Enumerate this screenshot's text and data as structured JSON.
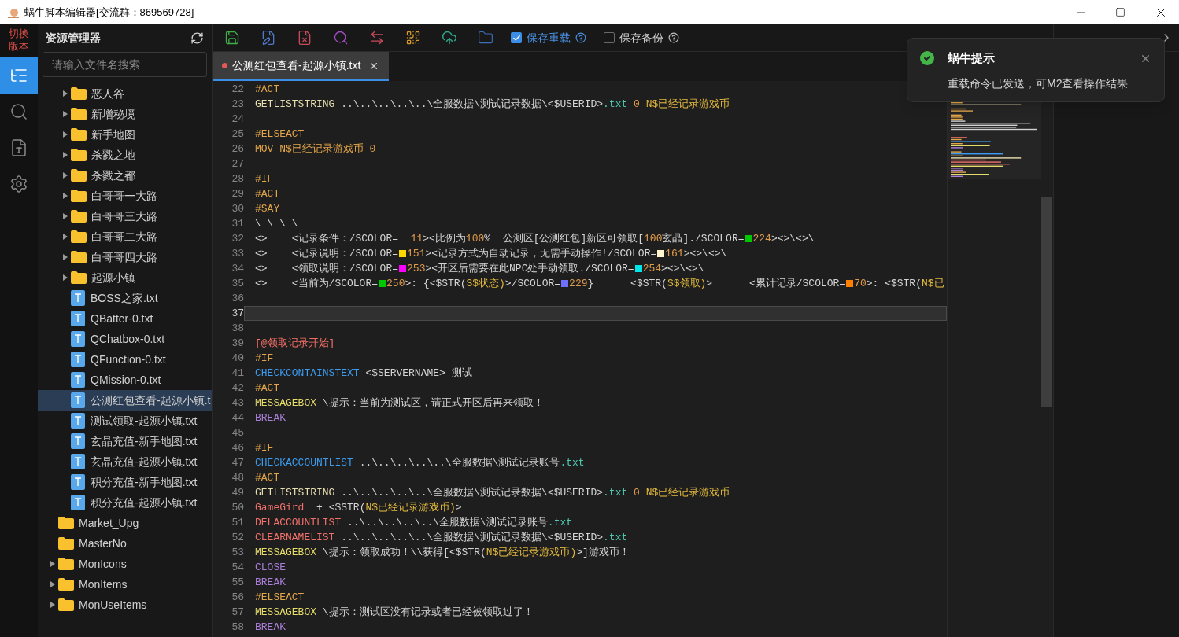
{
  "window": {
    "title": "蜗牛脚本编辑器[交流群：869569728]"
  },
  "activity_bar": {
    "switch_label": "切换版本",
    "items": [
      {
        "selected": true
      },
      {
        "selected": false
      },
      {
        "selected": false
      },
      {
        "selected": false
      }
    ]
  },
  "explorer": {
    "title": "资源管理器",
    "search": {
      "placeholder": "请输入文件名搜索"
    },
    "inner_items": [
      {
        "kind": "folder",
        "label": "恶人谷",
        "selected": false
      },
      {
        "kind": "folder",
        "label": "新增秘境",
        "selected": false
      },
      {
        "kind": "folder",
        "label": "新手地图",
        "selected": false
      },
      {
        "kind": "folder",
        "label": "杀戮之地",
        "selected": false
      },
      {
        "kind": "folder",
        "label": "杀戮之都",
        "selected": false
      },
      {
        "kind": "folder",
        "label": "白哥哥一大路",
        "selected": false
      },
      {
        "kind": "folder",
        "label": "白哥哥三大路",
        "selected": false
      },
      {
        "kind": "folder",
        "label": "白哥哥二大路",
        "selected": false
      },
      {
        "kind": "folder",
        "label": "白哥哥四大路",
        "selected": false
      },
      {
        "kind": "folder",
        "label": "起源小镇",
        "selected": false
      },
      {
        "kind": "file",
        "label": "BOSS之家.txt",
        "selected": false
      },
      {
        "kind": "file",
        "label": "QBatter-0.txt",
        "selected": false
      },
      {
        "kind": "file",
        "label": "QChatbox-0.txt",
        "selected": false
      },
      {
        "kind": "file",
        "label": "QFunction-0.txt",
        "selected": false
      },
      {
        "kind": "file",
        "label": "QMission-0.txt",
        "selected": false
      },
      {
        "kind": "file",
        "label": "公测红包查看-起源小镇.t",
        "selected": true
      },
      {
        "kind": "file",
        "label": "测试领取-起源小镇.txt",
        "selected": false
      },
      {
        "kind": "file",
        "label": "玄晶充值-新手地图.txt",
        "selected": false
      },
      {
        "kind": "file",
        "label": "玄晶充值-起源小镇.txt",
        "selected": false
      },
      {
        "kind": "file",
        "label": "积分充值-新手地图.txt",
        "selected": false
      },
      {
        "kind": "file",
        "label": "积分充值-起源小镇.txt",
        "selected": false
      }
    ],
    "outer_items": [
      {
        "kind": "leaf-folder",
        "label": "Market_Upg",
        "selected": false
      },
      {
        "kind": "leaf-folder",
        "label": "MasterNo",
        "selected": false
      },
      {
        "kind": "folder",
        "label": "MonIcons",
        "selected": false
      },
      {
        "kind": "folder",
        "label": "MonItems",
        "selected": false
      },
      {
        "kind": "folder",
        "label": "MonUseItems",
        "selected": false
      }
    ]
  },
  "toolbar": {
    "options": [
      {
        "label": "保存重载",
        "checked": true
      },
      {
        "label": "保存备份",
        "checked": false
      }
    ]
  },
  "tab": {
    "label": "公测红包查看-起源小镇.txt",
    "modified": true
  },
  "editor": {
    "lines": [
      {
        "n": "22",
        "current": false,
        "tokens": [
          {
            "kind": "dir",
            "text": "#ACT"
          }
        ]
      },
      {
        "n": "23",
        "current": false,
        "tokens": [
          {
            "kind": "cmd",
            "text": "GETLISTSTRING"
          },
          {
            "kind": "txt",
            "text": " ..\\..\\..\\..\\..\\全服数据\\测试记录数据\\<$USERID>"
          },
          {
            "kind": "ext",
            "text": ".txt"
          },
          {
            "kind": "num",
            "text": " 0"
          },
          {
            "kind": "var",
            "text": " N$已经记录游戏币"
          }
        ]
      },
      {
        "n": "24",
        "current": false
      },
      {
        "n": "25",
        "current": false,
        "tokens": [
          {
            "kind": "dir",
            "text": "#ELSEACT"
          }
        ]
      },
      {
        "n": "26",
        "current": false,
        "tokens": [
          {
            "kind": "dir",
            "text": "MOV N$已经记录游戏币 0"
          }
        ]
      },
      {
        "n": "27",
        "current": false
      },
      {
        "n": "28",
        "current": false,
        "tokens": [
          {
            "kind": "dir",
            "text": "#IF"
          }
        ]
      },
      {
        "n": "29",
        "current": false,
        "tokens": [
          {
            "kind": "dir",
            "text": "#ACT"
          }
        ]
      },
      {
        "n": "30",
        "current": false,
        "tokens": [
          {
            "kind": "dir",
            "text": "#SAY"
          }
        ]
      },
      {
        "n": "31",
        "current": false,
        "tokens": [
          {
            "kind": "txt",
            "text": "\\ \\ \\ \\"
          }
        ]
      },
      {
        "n": "32",
        "current": false,
        "tokens": [
          {
            "kind": "txt",
            "text": "<>    <记录条件：/SCOLOR=  "
          },
          {
            "kind": "num",
            "text": "11"
          },
          {
            "kind": "txt",
            "text": "><比例为"
          },
          {
            "kind": "num",
            "text": "100"
          },
          {
            "kind": "txt",
            "text": "%  公测区[公测红包]新区可领取["
          },
          {
            "kind": "num",
            "text": "100"
          },
          {
            "kind": "txt",
            "text": "玄晶]./SCOLOR="
          },
          {
            "kind": "swatch",
            "color": "#00c800"
          },
          {
            "kind": "num",
            "text": "224"
          },
          {
            "kind": "txt",
            "text": "><>\\<>\\"
          }
        ]
      },
      {
        "n": "33",
        "current": false,
        "tokens": [
          {
            "kind": "txt",
            "text": "<>    <记录说明：/SCOLOR="
          },
          {
            "kind": "swatch",
            "color": "#ffd700"
          },
          {
            "kind": "num",
            "text": "151"
          },
          {
            "kind": "txt",
            "text": "><记录方式为自动记录，无需手动操作!/SCOLOR="
          },
          {
            "kind": "swatch",
            "color": "#fff5cc"
          },
          {
            "kind": "num",
            "text": "161"
          },
          {
            "kind": "txt",
            "text": "><>\\<>\\"
          }
        ]
      },
      {
        "n": "34",
        "current": false,
        "tokens": [
          {
            "kind": "txt",
            "text": "<>    <领取说明：/SCOLOR="
          },
          {
            "kind": "swatch",
            "color": "#ff00ff"
          },
          {
            "kind": "num",
            "text": "253"
          },
          {
            "kind": "txt",
            "text": "><开区后需要在此NPC处手动领取./SCOLOR="
          },
          {
            "kind": "swatch",
            "color": "#00e5e5"
          },
          {
            "kind": "num",
            "text": "254"
          },
          {
            "kind": "txt",
            "text": "><>\\<>\\"
          }
        ]
      },
      {
        "n": "35",
        "current": false,
        "tokens": [
          {
            "kind": "txt",
            "text": "<>    <当前为/SCOLOR="
          },
          {
            "kind": "swatch",
            "color": "#00c800"
          },
          {
            "kind": "num",
            "text": "250"
          },
          {
            "kind": "txt",
            "text": ">: {<$STR("
          },
          {
            "kind": "var",
            "text": "S$状态)"
          },
          {
            "kind": "txt",
            "text": ">/SCOLOR="
          },
          {
            "kind": "swatch",
            "color": "#7070ff"
          },
          {
            "kind": "num",
            "text": "229"
          },
          {
            "kind": "txt",
            "text": "}      <$STR("
          },
          {
            "kind": "var",
            "text": "S$领取)"
          },
          {
            "kind": "txt",
            "text": ">      <累计记录/SCOLOR="
          },
          {
            "kind": "swatch",
            "color": "#ff8000"
          },
          {
            "kind": "num",
            "text": "70"
          },
          {
            "kind": "txt",
            "text": ">: <$STR("
          },
          {
            "kind": "var",
            "text": "N$已"
          }
        ]
      },
      {
        "n": "36",
        "current": false
      },
      {
        "n": "37",
        "current": true
      },
      {
        "n": "38",
        "current": false
      },
      {
        "n": "39",
        "current": false,
        "tokens": [
          {
            "kind": "label",
            "text": "[@领取记录开始]"
          }
        ]
      },
      {
        "n": "40",
        "current": false,
        "tokens": [
          {
            "kind": "dir",
            "text": "#IF"
          }
        ]
      },
      {
        "n": "41",
        "current": false,
        "tokens": [
          {
            "kind": "chk",
            "text": "CHECKCONTAINSTEXT"
          },
          {
            "kind": "txt",
            "text": " <$SERVERNAME> 测试"
          }
        ]
      },
      {
        "n": "42",
        "current": false,
        "tokens": [
          {
            "kind": "dir",
            "text": "#ACT"
          }
        ]
      },
      {
        "n": "43",
        "current": false,
        "tokens": [
          {
            "kind": "cmd2",
            "text": "MESSAGEBOX"
          },
          {
            "kind": "txt",
            "text": " \\提示：当前为测试区，请正式开区后再来领取！"
          }
        ]
      },
      {
        "n": "44",
        "current": false,
        "tokens": [
          {
            "kind": "ctl",
            "text": "BREAK"
          }
        ]
      },
      {
        "n": "45",
        "current": false
      },
      {
        "n": "46",
        "current": false,
        "tokens": [
          {
            "kind": "dir",
            "text": "#IF"
          }
        ]
      },
      {
        "n": "47",
        "current": false,
        "tokens": [
          {
            "kind": "chk",
            "text": "CHECKACCOUNTLIST"
          },
          {
            "kind": "txt",
            "text": " ..\\..\\..\\..\\..\\全服数据\\测试记录账号"
          },
          {
            "kind": "ext",
            "text": ".txt"
          }
        ]
      },
      {
        "n": "48",
        "current": false,
        "tokens": [
          {
            "kind": "dir",
            "text": "#ACT"
          }
        ]
      },
      {
        "n": "49",
        "current": false,
        "tokens": [
          {
            "kind": "cmd",
            "text": "GETLISTSTRING"
          },
          {
            "kind": "txt",
            "text": " ..\\..\\..\\..\\..\\全服数据\\测试记录数据\\<$USERID>"
          },
          {
            "kind": "ext",
            "text": ".txt"
          },
          {
            "kind": "num",
            "text": " 0"
          },
          {
            "kind": "var",
            "text": " N$已经记录游戏币"
          }
        ]
      },
      {
        "n": "50",
        "current": false,
        "tokens": [
          {
            "kind": "act",
            "text": "GameGird"
          },
          {
            "kind": "txt",
            "text": "  + <$STR("
          },
          {
            "kind": "var",
            "text": "N$已经记录游戏币)"
          },
          {
            "kind": "txt",
            "text": ">"
          }
        ]
      },
      {
        "n": "51",
        "current": false,
        "tokens": [
          {
            "kind": "act",
            "text": "DELACCOUNTLIST"
          },
          {
            "kind": "txt",
            "text": " ..\\..\\..\\..\\..\\全服数据\\测试记录账号"
          },
          {
            "kind": "ext",
            "text": ".txt"
          }
        ]
      },
      {
        "n": "52",
        "current": false,
        "tokens": [
          {
            "kind": "act",
            "text": "CLEARNAMELIST"
          },
          {
            "kind": "txt",
            "text": " ..\\..\\..\\..\\..\\全服数据\\测试记录数据\\<$USERID>"
          },
          {
            "kind": "ext",
            "text": ".txt"
          }
        ]
      },
      {
        "n": "53",
        "current": false,
        "tokens": [
          {
            "kind": "cmd2",
            "text": "MESSAGEBOX"
          },
          {
            "kind": "txt",
            "text": " \\提示：领取成功！\\\\获得[<$STR("
          },
          {
            "kind": "var",
            "text": "N$已经记录游戏币)"
          },
          {
            "kind": "txt",
            "text": ">]游戏币！"
          }
        ]
      },
      {
        "n": "54",
        "current": false,
        "tokens": [
          {
            "kind": "ctl",
            "text": "CLOSE"
          }
        ]
      },
      {
        "n": "55",
        "current": false,
        "tokens": [
          {
            "kind": "ctl",
            "text": "BREAK"
          }
        ]
      },
      {
        "n": "56",
        "current": false,
        "tokens": [
          {
            "kind": "dir",
            "text": "#ELSEACT"
          }
        ]
      },
      {
        "n": "57",
        "current": false,
        "tokens": [
          {
            "kind": "cmd2",
            "text": "MESSAGEBOX"
          },
          {
            "kind": "txt",
            "text": " \\提示：测试区没有记录或者已经被领取过了！"
          }
        ]
      },
      {
        "n": "58",
        "current": false,
        "tokens": [
          {
            "kind": "ctl",
            "text": "BREAK"
          }
        ]
      }
    ]
  },
  "toast": {
    "title": "蜗牛提示",
    "message": "重载命令已发送，可M2查看操作结果"
  }
}
